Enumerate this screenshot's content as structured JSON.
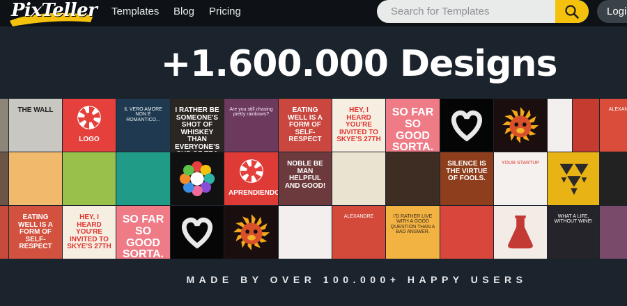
{
  "nav": {
    "logo": "PixTeller",
    "links": [
      "Templates",
      "Blog",
      "Pricing"
    ],
    "search_placeholder": "Search for Templates",
    "login_label": "Login"
  },
  "hero": {
    "title": "+1.600.000 Designs",
    "tagline": "MADE BY OVER 100.000+ HAPPY USERS"
  },
  "colors": {
    "background": "#1b232c",
    "nav_bg": "#0e1216",
    "accent_yellow": "#f4c20d"
  },
  "tiles": [
    {
      "bg": "#8e8579",
      "color": "#ffffff",
      "size": "sm",
      "text": ""
    },
    {
      "bg": "#c9c7c2",
      "color": "#1e1e1e",
      "size": "mid",
      "text": "THE WALL"
    },
    {
      "bg": "#e5403b",
      "color": "#ffffff",
      "size": "mid",
      "text": "LOGO",
      "icon": "aperture-icon"
    },
    {
      "bg": "#1f3a50",
      "color": "#e7eef3",
      "size": "sm",
      "text": "IL VERO AMORE NON È ROMANTICO..."
    },
    {
      "bg": "#2c2623",
      "color": "#ffffff",
      "size": "mid",
      "text": "I RATHER BE SOMEONE'S SHOT OF WHISKEY THAN EVERYONE'S CUP OF TEA"
    },
    {
      "bg": "#6b3a5c",
      "color": "#fde7ff",
      "size": "sm",
      "text": "Are you still chasing pretty rainbows?"
    },
    {
      "bg": "#c9473f",
      "color": "#ffffff",
      "size": "mid",
      "text": "EATING WELL IS A FORM OF SELF-RESPECT"
    },
    {
      "bg": "#f7eee2",
      "color": "#e0352f",
      "size": "mid",
      "text": "HEY, I HEARD YOU'RE INVITED TO SKYE'S 27TH"
    },
    {
      "bg": "#ef7b86",
      "color": "#ffffff",
      "size": "big",
      "text": "SO FAR SO GOOD SORTA."
    },
    {
      "bg": "#050505",
      "color": "#ffffff",
      "size": "mid",
      "text": "",
      "icon": "heart-hands-icon"
    },
    {
      "bg": "#1a0e0e",
      "color": "#f3b32b",
      "size": "mid",
      "text": "",
      "icon": "monkey-icon"
    },
    {
      "bg": "#f2efee",
      "color": "#c9262b",
      "size": "sm",
      "text": ""
    },
    {
      "bg": "#c63b2f",
      "color": "#ffffff",
      "size": "sm",
      "text": ""
    },
    {
      "bg": "#d94d3a",
      "color": "#ffffff",
      "size": "sm",
      "text": "ALEXANDRE"
    },
    {
      "bg": "#6b5547",
      "color": "#ffffff",
      "size": "sm",
      "text": ""
    },
    {
      "bg": "#f0b96b",
      "color": "#3a2a1a",
      "size": "sm",
      "text": ""
    },
    {
      "bg": "#99c04b",
      "color": "#ffffff",
      "size": "sm",
      "text": ""
    },
    {
      "bg": "#1f9b88",
      "color": "#ffffff",
      "size": "sm",
      "text": ""
    },
    {
      "bg": "#111111",
      "color": "#ffffff",
      "size": "sm",
      "text": "",
      "icon": "flower-icon"
    },
    {
      "bg": "#df3b36",
      "color": "#ffffff",
      "size": "mid",
      "text": "APRENDIENDO",
      "icon": "aperture-icon"
    },
    {
      "bg": "#6c3a3d",
      "color": "#ffffff",
      "size": "mid",
      "text": "NOBLE BE MAN HELPFUL AND GOOD!"
    },
    {
      "bg": "#e9e3cf",
      "color": "#4d6d78",
      "size": "sm",
      "text": ""
    },
    {
      "bg": "#3d2d22",
      "color": "#f4c25a",
      "size": "sm",
      "text": ""
    },
    {
      "bg": "#8e3e1c",
      "color": "#ffffff",
      "size": "mid",
      "text": "SILENCE IS THE VIRTUE OF FOOLS."
    },
    {
      "bg": "#f4f1ee",
      "color": "#e0362e",
      "size": "sm",
      "text": "YOUR STARTUP"
    },
    {
      "bg": "#e8b315",
      "color": "#2a2a2a",
      "size": "sm",
      "text": "",
      "icon": "triangles-icon"
    },
    {
      "bg": "#222222",
      "color": "#ffffff",
      "size": "sm",
      "text": ""
    },
    {
      "bg": "#c74b3d",
      "color": "#ffffff",
      "size": "sm",
      "text": ""
    },
    {
      "bg": "#d2513f",
      "color": "#ffffff",
      "size": "mid",
      "text": "EATING WELL IS A FORM OF SELF-RESPECT"
    },
    {
      "bg": "#f7eee2",
      "color": "#e0352f",
      "size": "mid",
      "text": "HEY, I HEARD YOU'RE INVITED TO SKYE'S 27TH"
    },
    {
      "bg": "#ef7b86",
      "color": "#ffffff",
      "size": "big",
      "text": "SO FAR SO GOOD SORTA."
    },
    {
      "bg": "#060606",
      "color": "#ffffff",
      "size": "mid",
      "text": "",
      "icon": "heart-hands-icon"
    },
    {
      "bg": "#1a0e0e",
      "color": "#f3b32b",
      "size": "mid",
      "text": "",
      "icon": "monkey-icon"
    },
    {
      "bg": "#f2efee",
      "color": "#c9262b",
      "size": "sm",
      "text": ""
    },
    {
      "bg": "#d3493a",
      "color": "#ffffff",
      "size": "sm",
      "text": "ALEXANDRE"
    },
    {
      "bg": "#f2b343",
      "color": "#3a2a1a",
      "size": "sm",
      "text": "I'D RATHER LIVE WITH A GOOD QUESTION THAN A BAD ANSWER."
    },
    {
      "bg": "#d9463c",
      "color": "#ffffff",
      "size": "sm",
      "text": ""
    },
    {
      "bg": "#f3ebe6",
      "color": "#c33a34",
      "size": "sm",
      "text": "",
      "icon": "flask-icon"
    },
    {
      "bg": "#25242a",
      "color": "#ffffff",
      "size": "sm",
      "text": "WHAT A LIFE, WITHOUT WINE!"
    },
    {
      "bg": "#7a4a6a",
      "color": "#ffffff",
      "size": "sm",
      "text": ""
    }
  ]
}
